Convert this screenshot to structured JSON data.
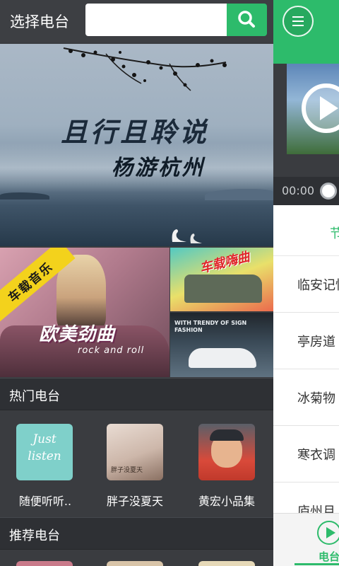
{
  "drawer": {
    "title": "选择电台",
    "search": {
      "value": "",
      "placeholder": "",
      "button_icon": "search-icon"
    },
    "banner": {
      "line1": "且行且聆说",
      "line2": "杨游杭州",
      "pages": 4,
      "active_page": 1
    },
    "tiles": {
      "big": {
        "ribbon": "车载音乐",
        "title": "欧美劲曲",
        "subtitle": "rock and roll"
      },
      "top": {
        "title": "车载嗨曲"
      },
      "bottom": {
        "text": "WITH TRENDY OF SIGN FASHION"
      }
    },
    "hot_section": {
      "title": "热门电台",
      "stations": [
        {
          "label": "随便听听..",
          "thumb_text1": "Just",
          "thumb_text2": "listen"
        },
        {
          "label": "胖子没夏天",
          "thumb_text": "胖子没夏天"
        },
        {
          "label": "黄宏小品集"
        }
      ]
    },
    "recommended_section": {
      "title": "推荐电台"
    }
  },
  "main": {
    "menu_icon": "hamburger-menu-icon",
    "player": {
      "time_current": "00:00",
      "play_icon": "play-icon"
    },
    "tab_label": "节",
    "programs": [
      "临安记忆",
      "亭房道",
      "冰菊物",
      "寒衣调",
      "庐州月"
    ],
    "bottom_nav": {
      "active_label": "电台",
      "active_icon": "play-circle-icon"
    }
  },
  "colors": {
    "accent": "#2dbb6b",
    "drawer_bg": "#3a3c40",
    "section_bg": "#2e3034"
  }
}
